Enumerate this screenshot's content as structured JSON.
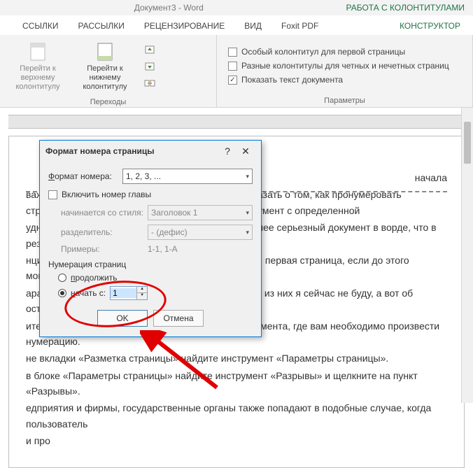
{
  "title": "Документ3 - Word",
  "contextual_tab": "РАБОТА С КОЛОНТИТУЛАМИ",
  "tabs": {
    "links": "ССЫЛКИ",
    "mailings": "РАССЫЛКИ",
    "review": "РЕЦЕНЗИРОВАНИЕ",
    "view": "ВИД",
    "foxit": "Foxit PDF",
    "design": "КОНСТРУКТОР"
  },
  "ribbon": {
    "goto_header": "Перейти к верхнему колонтитулу",
    "goto_footer": "Перейти к нижнему колонтитулу",
    "group_nav": "Переходы",
    "chk_first": "Особый колонтитул для первой страницы",
    "chk_odd_even": "Разные колонтитулы для четных и нечетных страниц",
    "chk_show_doc": "Показать текст документа",
    "group_params": "Параметры"
  },
  "body_lines": [
    "начала",
    "важаемые пользователи, сегодня я хочу вам рассказать о том, как пронумеровать страницы в версии Word 2010. Пронумеровать документ с определенной",
    "удно представить себе какой-нибудь более или менее серьезный документ в ворде, что в результате вы получили",
    "нцию, основан на разделении документа так, чтобы первая страница, если до этого момента вы не задействовали один",
    "араметров». Подробно останавливаться на каждом из них я сейчас не буду, а вот об остальных расскажем, давайте по порядку.",
    "ите курсор на первой строке первой страницы документа, где вам необходимо произвести нумерацию.",
    "не вкладки «Разметка страницы» найдите инструмент «Параметры страницы».",
    "в блоке «Параметры страницы» найдите инструмент «Разрывы» и щелкните на пункт «Разрывы».",
    "едприятия и фирмы, государственные органы также попадают в подобные случае, когда пользователь",
    "и про"
  ],
  "dialog": {
    "title": "Формат номера страницы",
    "format_label": "Формат номера:",
    "format_value": "1, 2, 3, ...",
    "include_chapter": "Включить номер главы",
    "starts_style_label": "начинается со стиля:",
    "starts_style_value": "Заголовок 1",
    "separator_label": "разделитель:",
    "separator_value": "-   (дефис)",
    "examples_label": "Примеры:",
    "examples_value": "1-1, 1-A",
    "page_numbering": "Нумерация страниц",
    "radio_continue": "продолжить",
    "radio_start_at": "начать с:",
    "start_value": "1",
    "ok": "OK",
    "cancel": "Отмена"
  }
}
